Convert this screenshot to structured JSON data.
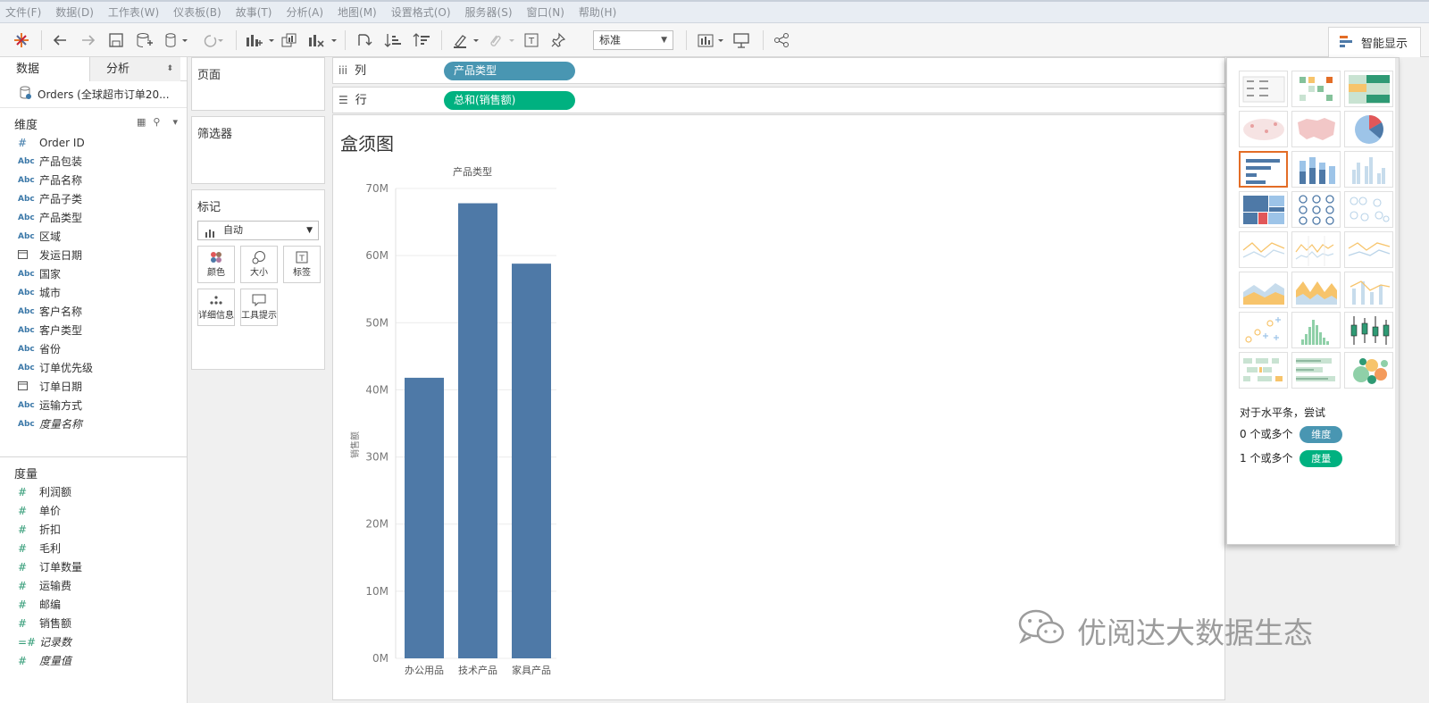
{
  "menu": [
    "文件(F)",
    "数据(D)",
    "工作表(W)",
    "仪表板(B)",
    "故事(T)",
    "分析(A)",
    "地图(M)",
    "设置格式(O)",
    "服务器(S)",
    "窗口(N)",
    "帮助(H)"
  ],
  "toolbar": {
    "fit_select": "标准",
    "show_me_label": "智能显示"
  },
  "left_pane": {
    "tabs": [
      "数据",
      "分析"
    ],
    "datasource": "Orders (全球超市订单20...",
    "dimensions_header": "维度",
    "dimensions": [
      {
        "type": "#",
        "name": "Order ID"
      },
      {
        "type": "Abc",
        "name": "产品包装"
      },
      {
        "type": "Abc",
        "name": "产品名称"
      },
      {
        "type": "Abc",
        "name": "产品子类"
      },
      {
        "type": "Abc",
        "name": "产品类型"
      },
      {
        "type": "Abc",
        "name": "区域"
      },
      {
        "type": "date",
        "name": "发运日期"
      },
      {
        "type": "Abc",
        "name": "国家"
      },
      {
        "type": "Abc",
        "name": "城市"
      },
      {
        "type": "Abc",
        "name": "客户名称"
      },
      {
        "type": "Abc",
        "name": "客户类型"
      },
      {
        "type": "Abc",
        "name": "省份"
      },
      {
        "type": "Abc",
        "name": "订单优先级"
      },
      {
        "type": "date",
        "name": "订单日期"
      },
      {
        "type": "Abc",
        "name": "运输方式"
      },
      {
        "type": "Abc",
        "name": "度量名称"
      }
    ],
    "measures_header": "度量",
    "measures": [
      {
        "type": "#",
        "name": "利润额"
      },
      {
        "type": "#",
        "name": "单价"
      },
      {
        "type": "#",
        "name": "折扣"
      },
      {
        "type": "#",
        "name": "毛利"
      },
      {
        "type": "#",
        "name": "订单数量"
      },
      {
        "type": "#",
        "name": "运输费"
      },
      {
        "type": "#",
        "name": "邮编"
      },
      {
        "type": "#",
        "name": "销售额"
      },
      {
        "type": "=#",
        "name": "记录数"
      },
      {
        "type": "#",
        "name": "度量值"
      }
    ]
  },
  "cards": {
    "pages": "页面",
    "filters": "筛选器",
    "marks": "标记",
    "mark_type": "自动",
    "buttons": [
      "颜色",
      "大小",
      "标签",
      "详细信息",
      "工具提示"
    ]
  },
  "shelves": {
    "columns_label": "列",
    "rows_label": "行",
    "columns_pill": "产品类型",
    "rows_pill": "总和(销售额)"
  },
  "view": {
    "title": "盒须图"
  },
  "chart_data": {
    "type": "bar",
    "title": "",
    "xlabel": "产品类型",
    "ylabel": "销售额",
    "categories": [
      "办公用品",
      "技术产品",
      "家具产品"
    ],
    "values": [
      41800000,
      67800000,
      58800000
    ],
    "ylim": [
      0,
      70000000
    ],
    "yticks": [
      0,
      10000000,
      20000000,
      30000000,
      40000000,
      50000000,
      60000000,
      70000000
    ],
    "ytick_labels": [
      "0M",
      "10M",
      "20M",
      "30M",
      "40M",
      "50M",
      "60M",
      "70M"
    ],
    "bar_color": "#4e79a7",
    "grid": true
  },
  "show_me": {
    "hint_title": "对于水平条，尝试",
    "hint_dim": "0 个或多个",
    "dim_badge": "维度",
    "hint_meas": "1 个或多个",
    "meas_badge": "度量",
    "selected": "horizontal-bars"
  },
  "colors": {
    "dimension_pill": "#4996b2",
    "measure_pill": "#00b180",
    "accent": "#e36d26"
  },
  "watermark": "优阅达大数据生态"
}
